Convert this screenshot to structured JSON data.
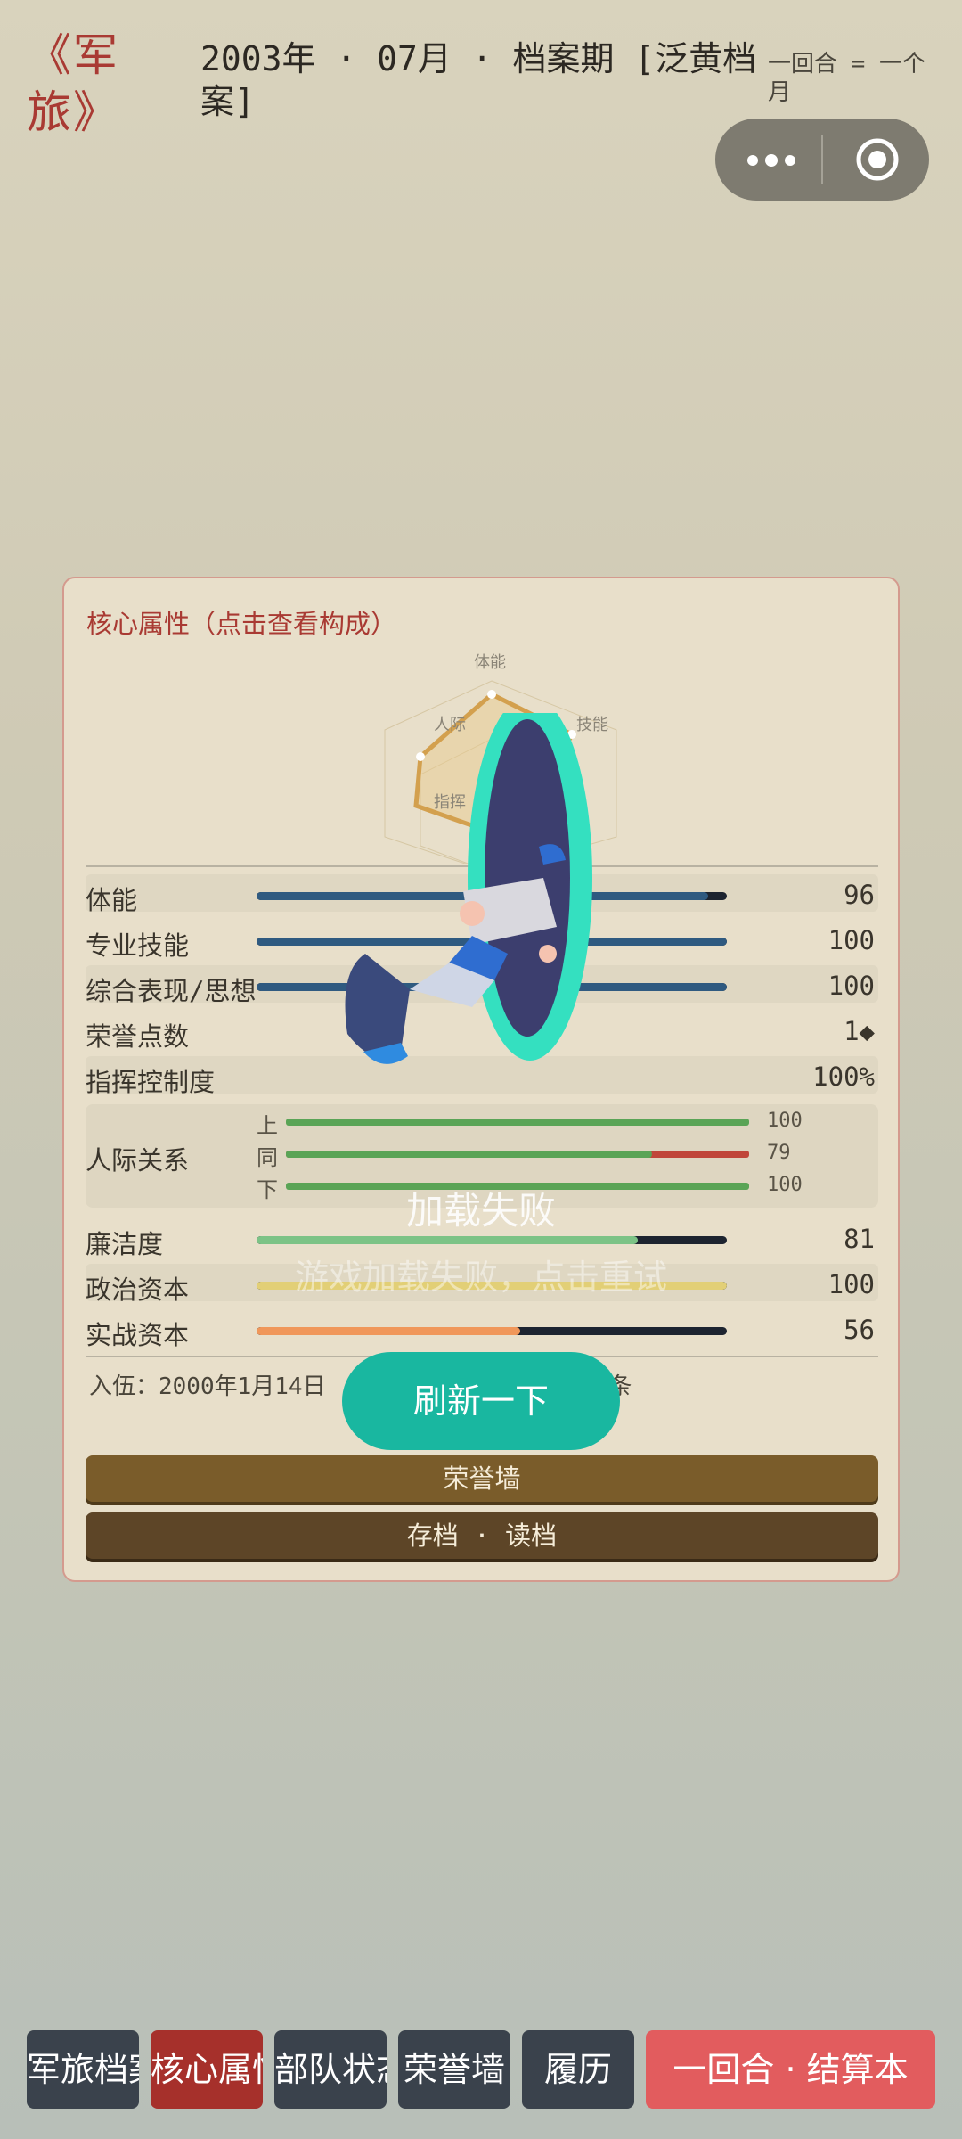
{
  "header": {
    "game_title": "《军旅》",
    "period": "2003年 · 07月 · 档案期 [泛黄档案]",
    "turn_note": "一回合 = 一个月"
  },
  "card": {
    "title": "核心属性（点击查看构成）",
    "radar_labels": [
      "体能",
      "技能",
      "人际",
      "指挥"
    ],
    "stats": [
      {
        "label": "体能",
        "value": "96",
        "fraction": 0.96,
        "color": "#2f5a80"
      },
      {
        "label": "专业技能",
        "value": "100",
        "fraction": 1.0,
        "color": "#2f5a80"
      },
      {
        "label": "综合表现/思想",
        "value": "100",
        "fraction": 1.0,
        "color": "#2f5a80"
      }
    ],
    "honor_points_label": "荣誉点数",
    "honor_points_value": "1◆",
    "command_label": "指挥控制度",
    "command_value": "100%",
    "relations": {
      "label": "人际关系",
      "rows": [
        {
          "label": "上",
          "value": "100",
          "fraction": 1.0
        },
        {
          "label": "同",
          "value": "79",
          "fraction": 0.79
        },
        {
          "label": "下",
          "value": "100",
          "fraction": 1.0
        }
      ]
    },
    "bottom_stats": [
      {
        "label": "廉洁度",
        "value": "81",
        "fraction": 0.81,
        "color": "#7cc386"
      },
      {
        "label": "政治资本",
        "value": "100",
        "fraction": 1.0,
        "color": "#e2cf76"
      },
      {
        "label": "实战资本",
        "value": "56",
        "fraction": 0.56,
        "color": "#f0975a"
      }
    ],
    "meta_text": "入伍：2000年1月14日 · 荣誉 1 条 · 消息 1 条",
    "honor_wall_button": "荣誉墙",
    "save_load_button": "存档 · 读档"
  },
  "overlay": {
    "fail_title": "加载失败",
    "fail_subtitle": "游戏加载失败，点击重试",
    "refresh_button": "刷新一下"
  },
  "tabs": [
    {
      "label": "军旅档案"
    },
    {
      "label": "核心属性"
    },
    {
      "label": "部队状态"
    },
    {
      "label": "荣誉墙"
    },
    {
      "label": "履历"
    },
    {
      "label": "一回合 · 结算本"
    }
  ],
  "colors": {
    "accent": "#a93a33",
    "card_bg": "#e8dfca",
    "stat_blue": "#2f5a80",
    "relation_green": "#5aa456",
    "relation_red": "#c0463a",
    "refresh": "#19b7a0"
  }
}
